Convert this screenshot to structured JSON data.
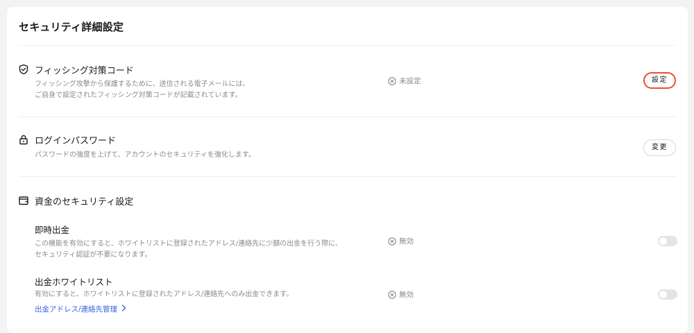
{
  "page": {
    "title": "セキュリティ詳細設定"
  },
  "sections": {
    "phishing": {
      "icon": "shield-check-icon",
      "title": "フィッシング対策コード",
      "desc_line1": "フィッシング攻撃から保護するために、送信される電子メールには、",
      "desc_line2": "ご自身で設定されたフィッシング対策コードが記載されています。",
      "status": "未設定",
      "button": "設定"
    },
    "password": {
      "icon": "lock-icon",
      "title": "ログインパスワード",
      "desc": "パスワードの強度を上げて、アカウントのセキュリティを強化します。",
      "button": "変更"
    },
    "funds": {
      "icon": "wallet-icon",
      "title": "資金のセキュリティ設定",
      "instant": {
        "title": "即時出金",
        "desc_line1": "この機能を有効にすると、ホワイトリストに登録されたアドレス/連絡先に少額の出金を行う際に、",
        "desc_line2": "セキュリティ認証が不要になります。",
        "status": "無効",
        "enabled": false
      },
      "whitelist": {
        "title": "出金ホワイトリスト",
        "desc": "有効にすると、ホワイトリストに登録されたアドレス/連絡先へのみ出金できます。",
        "status": "無効",
        "enabled": false,
        "link": "出金アドレス/連絡先管理"
      }
    }
  },
  "colors": {
    "accent_link": "#3a62e0",
    "highlight_border": "#e8502b",
    "muted_text": "#8a8a8f"
  }
}
